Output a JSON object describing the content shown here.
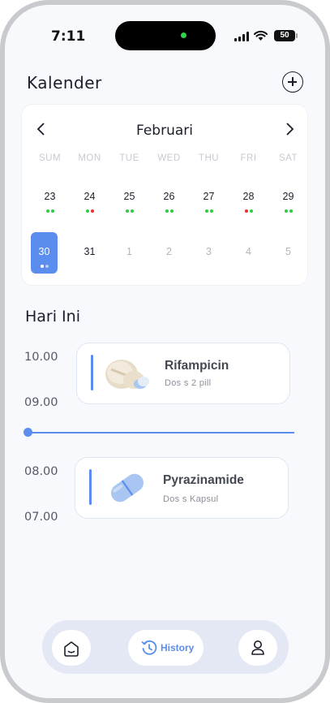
{
  "status_bar": {
    "time": "7:11",
    "battery": "50"
  },
  "header": {
    "title": "Kalender",
    "add_icon": "plus-circle-icon"
  },
  "calendar": {
    "month": "Februari",
    "weekdays": [
      "SUM",
      "MON",
      "TUE",
      "WED",
      "THU",
      "FRI",
      "SAT"
    ],
    "week1": [
      "23",
      "24",
      "25",
      "26",
      "27",
      "28",
      "29"
    ],
    "week2": [
      "30",
      "31",
      "1",
      "2",
      "3",
      "4",
      "5"
    ],
    "selected": "30",
    "colors": {
      "accent": "#5b8def",
      "taken": "#2ecc40",
      "missed": "#e8322f"
    }
  },
  "today": {
    "heading": "Hari Ini",
    "times": [
      "10.00",
      "09.00",
      "08.00",
      "07.00"
    ],
    "meds": [
      {
        "name": "Rifampicin",
        "dose": "Dos s 2 pill",
        "icon": "pills-icon"
      },
      {
        "name": "Pyrazinamide",
        "dose": "Dos s Kapsul",
        "icon": "capsule-icon"
      }
    ]
  },
  "nav": {
    "home_icon": "home-icon",
    "history_label": "History",
    "history_icon": "history-icon",
    "profile_icon": "user-icon"
  }
}
